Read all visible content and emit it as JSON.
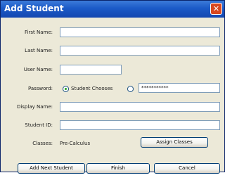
{
  "window": {
    "title": "Add Student",
    "close_glyph": "✕"
  },
  "form": {
    "first_name": {
      "label": "First Name:",
      "value": ""
    },
    "last_name": {
      "label": "Last Name:",
      "value": ""
    },
    "user_name": {
      "label": "User Name:",
      "value": ""
    },
    "password": {
      "label": "Password:",
      "option_student_chooses": "Student Chooses",
      "selected": "student_chooses",
      "value": "***********"
    },
    "display_name": {
      "label": "Display Name:",
      "value": ""
    },
    "student_id": {
      "label": "Student ID:",
      "value": ""
    },
    "classes": {
      "label": "Classes:",
      "value": "Pre-Calculus"
    }
  },
  "buttons": {
    "assign_classes": "Assign Classes",
    "add_next_student": "Add Next Student",
    "finish": "Finish",
    "cancel": "Cancel"
  }
}
